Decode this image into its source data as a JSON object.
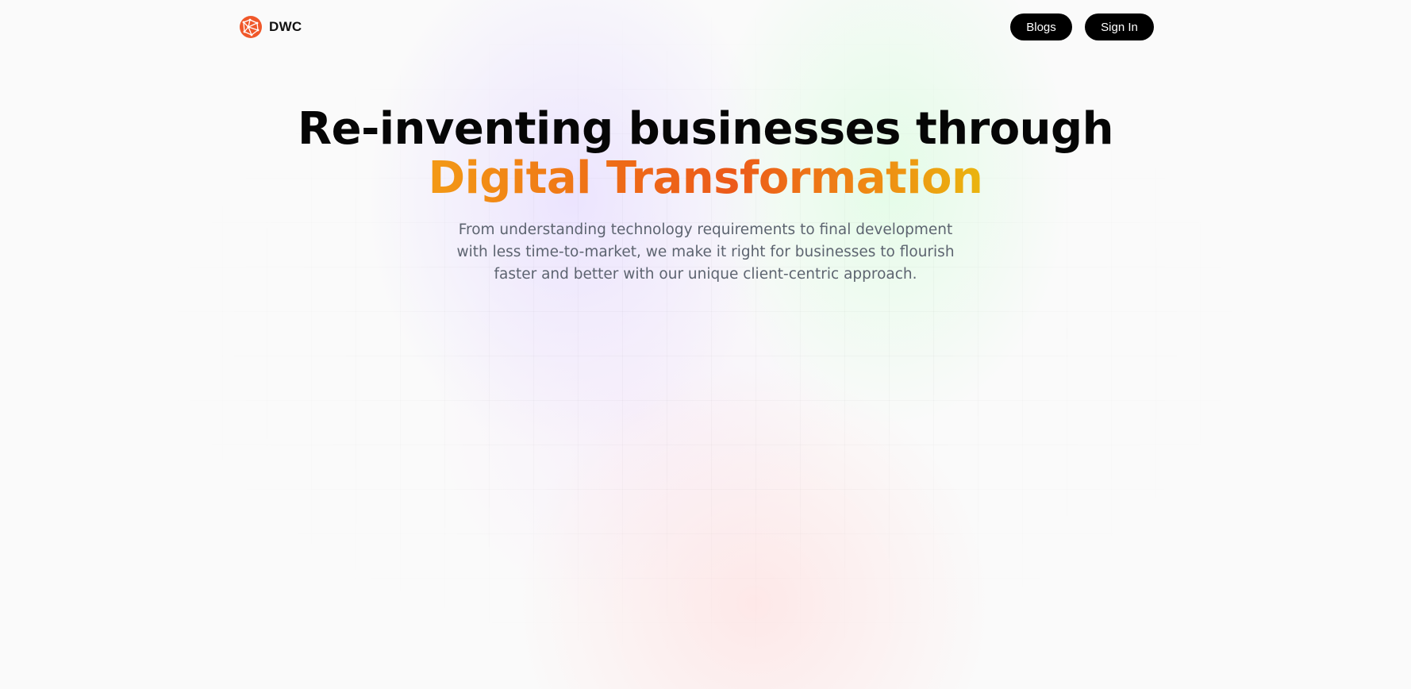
{
  "brand": {
    "name": "DWC",
    "logo_icon": "globe-network-icon",
    "logo_color": "#f0582a"
  },
  "nav": {
    "blogs_label": "Blogs",
    "signin_label": "Sign In"
  },
  "hero": {
    "headline_line1": "Re-inventing businesses through",
    "headline_line2": "Digital Transformation",
    "subtitle": "From understanding technology requirements to final development with less time-to-market, we make it right for businesses to flourish faster and better with our unique client-centric approach."
  },
  "colors": {
    "button_bg": "#000000",
    "button_text": "#ffffff",
    "gradient_start": "#f39a16",
    "gradient_mid": "#ec5a1a",
    "gradient_end": "#eab50f",
    "subtitle_text": "#5d6470"
  }
}
